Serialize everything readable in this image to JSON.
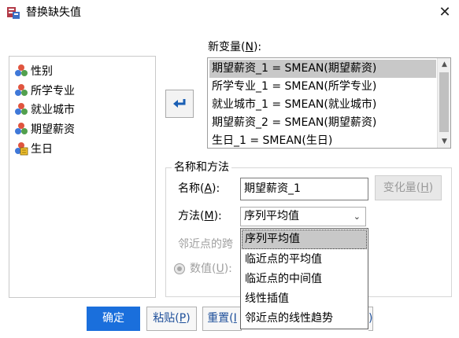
{
  "window": {
    "title": "替换缺失值",
    "close_glyph": "✕"
  },
  "variables": [
    {
      "label": "性别",
      "icon": "nominal-variable-icon"
    },
    {
      "label": "所学专业",
      "icon": "nominal-variable-icon"
    },
    {
      "label": "就业城市",
      "icon": "nominal-variable-icon"
    },
    {
      "label": "期望薪资",
      "icon": "nominal-variable-icon"
    },
    {
      "label": "生日",
      "icon": "date-variable-icon"
    }
  ],
  "new_variable": {
    "label_prefix": "新变量(",
    "mnemonic": "N",
    "label_suffix": "):",
    "items": [
      "期望薪资_1 = SMEAN(期望薪资)",
      "所学专业_1 = SMEAN(所学专业)",
      "就业城市_1 = SMEAN(就业城市)",
      "期望薪资_2 = SMEAN(期望薪资)",
      "生日_1 = SMEAN(生日)"
    ],
    "selected_index": 0
  },
  "name_and_method": {
    "group_title": "名称和方法",
    "name_label_prefix": "名称(",
    "name_mnemonic": "A",
    "name_label_suffix": "):",
    "name_value": "期望薪资_1",
    "change_label_prefix": "变化量(",
    "change_mnemonic": "H",
    "change_label_suffix": ")",
    "method_label_prefix": "方法(",
    "method_mnemonic": "M",
    "method_label_suffix": "):",
    "method_value": "序列平均值",
    "adjacent_label": "邻近点的跨",
    "numeric_label_prefix": "数值(",
    "numeric_mnemonic": "U",
    "numeric_label_suffix": "):"
  },
  "method_options": [
    "序列平均值",
    "临近点的平均值",
    "临近点的中间值",
    "线性插值",
    "邻近点的线性趋势"
  ],
  "buttons": {
    "ok": "确定",
    "paste_prefix": "粘贴(",
    "paste_mnemonic": "P",
    "paste_suffix": ")",
    "reset_prefix": "重置(",
    "reset_mnemonic": "I",
    "extra": ")"
  },
  "colors": {
    "accent": "#1a6fdc",
    "selection": "#c8c8c8"
  }
}
